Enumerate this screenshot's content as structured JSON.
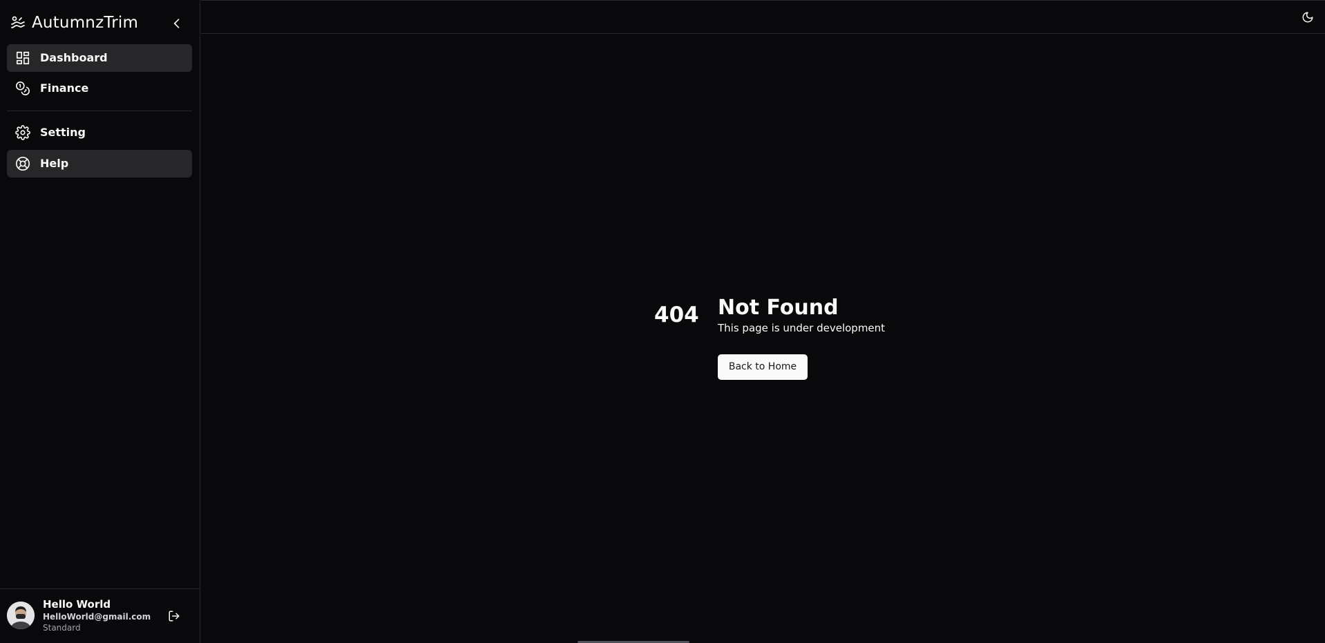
{
  "app": {
    "brand_name": "AutumnzTrim"
  },
  "sidebar": {
    "items": [
      {
        "label": "Dashboard",
        "icon": "dashboard-icon",
        "active": true
      },
      {
        "label": "Finance",
        "icon": "coins-icon",
        "active": false
      },
      {
        "label": "Setting",
        "icon": "gear-icon",
        "active": false
      },
      {
        "label": "Help",
        "icon": "life-buoy-icon",
        "active": true
      }
    ]
  },
  "user": {
    "name": "Hello World",
    "email": "HelloWorld@gmail.com",
    "plan": "Standard"
  },
  "main": {
    "code": "404",
    "title": "Not Found",
    "subtitle": "This page is under development",
    "button_label": "Back to Home"
  },
  "colors": {
    "background": "#09090b",
    "active_item": "#27272a",
    "border": "#27272a",
    "button_bg": "#fafafa",
    "button_text": "#18181b"
  }
}
